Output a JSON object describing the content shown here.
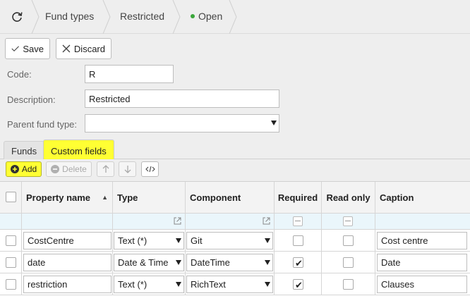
{
  "breadcrumb": {
    "items": [
      "Fund types",
      "Restricted",
      "Open"
    ],
    "status_color": "#3aa63a"
  },
  "toolbar": {
    "save_label": "Save",
    "discard_label": "Discard"
  },
  "form": {
    "code_label": "Code:",
    "code_value": "R",
    "description_label": "Description:",
    "description_value": "Restricted",
    "parent_label": "Parent fund type:",
    "parent_value": ""
  },
  "tabs": [
    {
      "label": "Funds",
      "active": false
    },
    {
      "label": "Custom fields",
      "active": true,
      "highlight": "#ffff33"
    }
  ],
  "grid_toolbar": {
    "add_label": "Add",
    "delete_label": "Delete"
  },
  "table": {
    "headers": [
      "Property name",
      "Type",
      "Component",
      "Required",
      "Read only",
      "Caption"
    ],
    "sort_column": "Property name",
    "sort_direction": "ascending",
    "rows": [
      {
        "property": "CostCentre",
        "type": "Text (*)",
        "component": "Git",
        "required": false,
        "read_only": false,
        "caption": "Cost centre"
      },
      {
        "property": "date",
        "type": "Date & Time",
        "component": "DateTime",
        "required": true,
        "read_only": false,
        "caption": "Date"
      },
      {
        "property": "restriction",
        "type": "Text (*)",
        "component": "RichText",
        "required": true,
        "read_only": false,
        "caption": "Clauses"
      }
    ]
  }
}
